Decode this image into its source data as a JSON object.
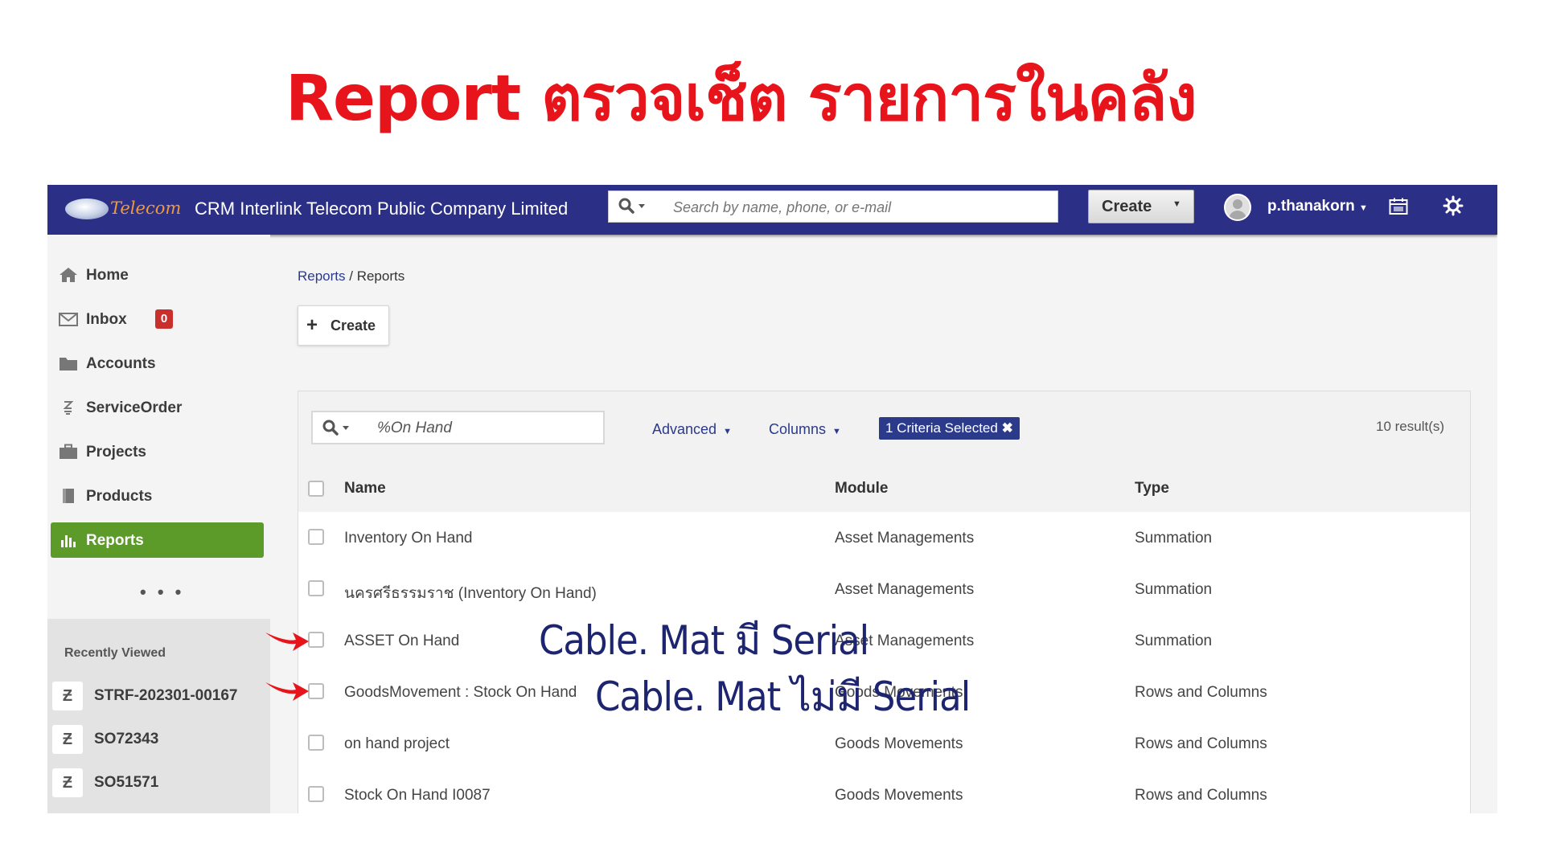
{
  "slide": {
    "title": "Report ตรวจเช็ต รายการในคลัง"
  },
  "topbar": {
    "logo_text": "Telecom",
    "app_title": "CRM Interlink Telecom Public Company Limited",
    "search_placeholder": "Search by name, phone, or e-mail",
    "create_label": "Create",
    "username": "p.thanakorn",
    "icons": [
      "search-icon",
      "calendar-icon",
      "gear-icon",
      "user-avatar"
    ]
  },
  "sidebar": {
    "items": [
      {
        "label": "Home",
        "icon": "home-icon"
      },
      {
        "label": "Inbox",
        "icon": "envelope-icon",
        "badge": "0"
      },
      {
        "label": "Accounts",
        "icon": "folder-icon"
      },
      {
        "label": "ServiceOrder",
        "icon": "service-order-icon"
      },
      {
        "label": "Projects",
        "icon": "briefcase-icon"
      },
      {
        "label": "Products",
        "icon": "book-icon"
      },
      {
        "label": "Reports",
        "icon": "bar-chart-icon",
        "active": true
      }
    ],
    "more": "• • •",
    "recently_viewed_title": "Recently Viewed",
    "recent": [
      {
        "label": "STRF-202301-00167"
      },
      {
        "label": "SO72343"
      },
      {
        "label": "SO51571"
      }
    ]
  },
  "main": {
    "breadcrumb": {
      "link": "Reports",
      "separator": " / ",
      "current": "Reports"
    },
    "create_label": "Create",
    "filter": {
      "search_value": "%On Hand",
      "advanced_label": "Advanced",
      "columns_label": "Columns",
      "criteria_label": "1 Criteria Selected",
      "results": "10 result(s)"
    },
    "table": {
      "headers": [
        "Name",
        "Module",
        "Type"
      ],
      "rows": [
        [
          "Inventory On Hand",
          "Asset Managements",
          "Summation"
        ],
        [
          "นครศรีธรรมราช (Inventory On Hand)",
          "Asset Managements",
          "Summation"
        ],
        [
          "ASSET On Hand",
          "Asset Managements",
          "Summation"
        ],
        [
          "GoodsMovement : Stock On Hand",
          "Goods Movements",
          "Rows and Columns"
        ],
        [
          "on hand project",
          "Goods Movements",
          "Rows and Columns"
        ],
        [
          "Stock On Hand I0087",
          "Goods Movements",
          "Rows and Columns"
        ]
      ]
    }
  },
  "annotations": {
    "line1": "Cable. Mat มี Serial",
    "line2": "Cable. Mat ไม่มี Serial",
    "arrow_color": "#e8141b"
  },
  "colors": {
    "title_red": "#e8141b",
    "navbar": "#2b2f86",
    "active_green": "#5c9a2a",
    "link_blue": "#2b3a8a"
  }
}
